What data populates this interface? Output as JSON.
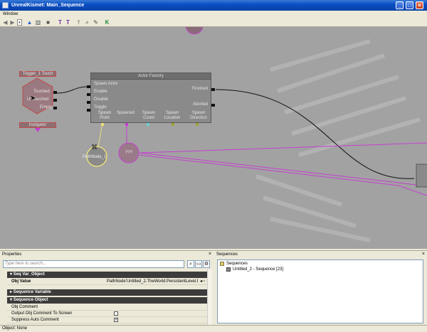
{
  "window": {
    "title": "UnrealKismet: Main_Sequence",
    "minimize": "_",
    "maximize": "□",
    "close": "×"
  },
  "menu": {
    "items": [
      "Window"
    ]
  },
  "toolbar": {
    "icons": [
      "back-arrow",
      "forward-arrow",
      "dropdown",
      "parent-sequence",
      "open-sequence",
      "screenshot",
      "text-tool",
      "text-tool-2",
      "search",
      "zoom",
      "link",
      "kismet-k"
    ]
  },
  "graph": {
    "trigger": {
      "title": "Trigger_1 Touch",
      "touched": "Touched",
      "untouched": "UnTouched",
      "empty": "Empty",
      "instigator": "Instigator"
    },
    "actor_factory": {
      "title": "Actor Factory",
      "inputs": [
        "Spawn Actor",
        "Enable",
        "Disable",
        "Toggle"
      ],
      "outputs": [
        "Finished",
        "Aborted"
      ],
      "vars": [
        "Spawn Point",
        "Spawned",
        "Spawn Count",
        "Spawn Location",
        "Spawn Direction"
      ]
    },
    "pathnode_var": "PathNode_1",
    "unknown_var": "???",
    "colors": {
      "canvas": "#a2a2a2",
      "link_purple": "#c63fd0",
      "link_yellow": "#e8e07a",
      "var_node": "#9a7a88"
    }
  },
  "properties": {
    "title": "Properties",
    "search_placeholder": "Type here to search...",
    "sections": [
      {
        "label": "Seq Var_Object"
      },
      {
        "label": "Sequence Variable"
      },
      {
        "label": "Sequence Object"
      }
    ],
    "obj_value_label": "Obj Value",
    "obj_value": "PathNode'Untitled_2.TheWorld:PersistentLevel.PathNode_1'",
    "obj_comment_label": "Obj Comment",
    "output_comment_label": "Output Obj Comment To Screen",
    "output_comment_checked": false,
    "suppress_label": "Suppress Auto Comment",
    "suppress_checked": true
  },
  "sequences": {
    "title": "Sequences",
    "root": "Sequences",
    "items": [
      "Untitled_2 - Sequence [23]"
    ]
  },
  "status": {
    "text": "Object: None"
  }
}
